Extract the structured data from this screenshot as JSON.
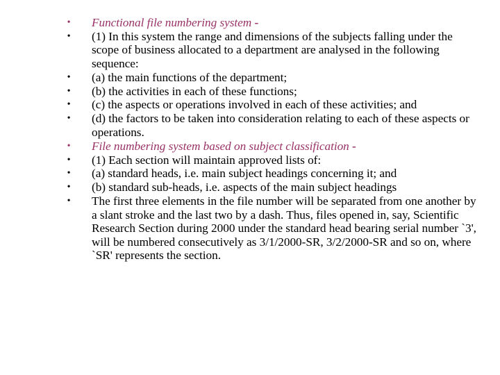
{
  "colors": {
    "heading": "#993366",
    "body": "#000000",
    "background": "#ffffff"
  },
  "bullet_glyph": "•",
  "items": [
    {
      "type": "heading",
      "text": "Functional file numbering system",
      "suffix": " -"
    },
    {
      "type": "body",
      "text": "(1)  In this system the range and dimensions of the subjects falling under the scope of business allocated to a department are analysed in the following sequence:"
    },
    {
      "type": "body",
      "text": "(a)  the main functions of the department;"
    },
    {
      "type": "body",
      "text": "(b)  the activities in each of these functions;"
    },
    {
      "type": "body",
      "text": "(c)  the aspects or operations involved in each of these activities; and"
    },
    {
      "type": "body",
      "text": "(d)  the factors to be taken into consideration relating to each of these aspects or operations."
    },
    {
      "type": "heading",
      "text": "File numbering system based on subject classification",
      "suffix": " -"
    },
    {
      "type": "body",
      "text": "(1)  Each section will maintain approved lists of:"
    },
    {
      "type": "body",
      "text": "(a)  standard heads, i.e. main subject headings concerning it; and"
    },
    {
      "type": "body",
      "text": "(b)  standard sub-heads, i.e. aspects of the main subject headings"
    },
    {
      "type": "body",
      "text": "The first three elements in the file number will be separated from one another by a slant stroke and the last two by a dash. Thus, files opened in, say, Scientific Research Section during 2000 under the standard head bearing serial number `3', will be numbered consecutively as 3/1/2000-SR, 3/2/2000-SR and so on, where `SR' represents the section."
    }
  ]
}
